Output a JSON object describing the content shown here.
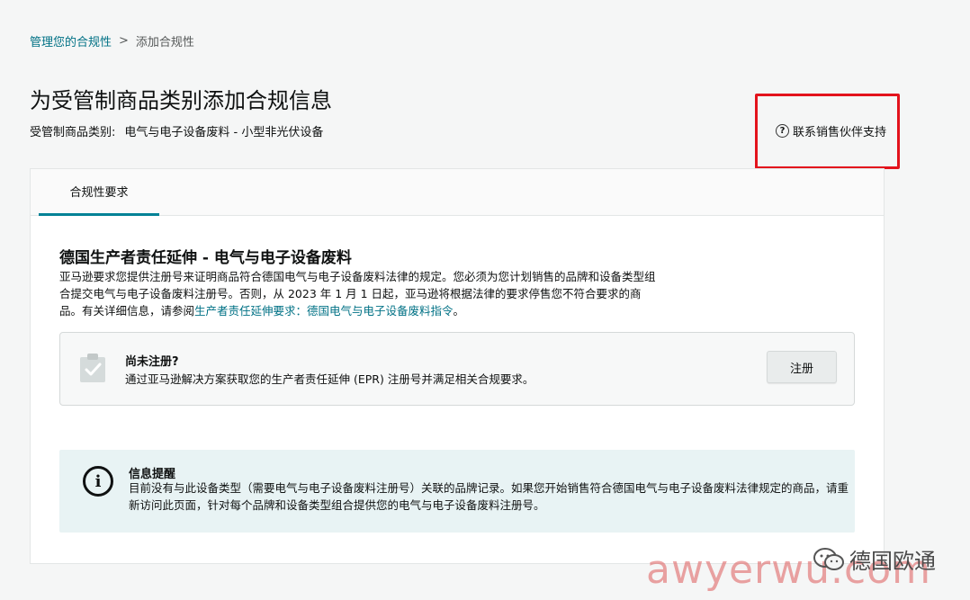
{
  "breadcrumb": {
    "parent": "管理您的合规性",
    "separator": ">",
    "current": "添加合规性"
  },
  "page": {
    "title": "为受管制商品类别添加合规信息",
    "category_label": "受管制商品类别:",
    "category_value": "电气与电子设备废料 - 小型非光伏设备"
  },
  "support": {
    "icon": "question-circle-icon",
    "label": "联系销售伙伴支持",
    "highlight_color": "#e3131c"
  },
  "tabs": [
    {
      "label": "合规性要求",
      "active": true
    }
  ],
  "section": {
    "title": "德国生产者责任延伸 - 电气与电子设备废料",
    "desc_part1": "亚马逊要求您提供注册号来证明商品符合德国电气与电子设备废料法律的规定。您必须为您计划销售的品牌和设备类型组合提交电气与电子设备废料注册号。否则，从 2023 年 1 月 1 日起，亚马逊将根据法律的要求停售您不符合要求的商品。有关详细信息，请参阅",
    "desc_link": "生产者责任延伸要求：德国电气与电子设备废料指令",
    "desc_part2": "。"
  },
  "register": {
    "title": "尚未注册?",
    "desc": "通过亚马逊解决方案获取您的生产者责任延伸 (EPR) 注册号并满足相关合规要求。",
    "button": "注册"
  },
  "info": {
    "title": "信息提醒",
    "desc": "目前没有与此设备类型（需要电气与电子设备废料注册号）关联的品牌记录。如果您开始销售符合德国电气与电子设备废料法律规定的商品，请重新访问此页面，针对每个品牌和设备类型组合提供您的电气与电子设备废料注册号。"
  },
  "watermark": {
    "wechat_name": "德国欧通",
    "url": "awyerwu.com"
  },
  "colors": {
    "link": "#007185",
    "tab_underline": "#008296",
    "info_bg": "#e8f3f4"
  }
}
